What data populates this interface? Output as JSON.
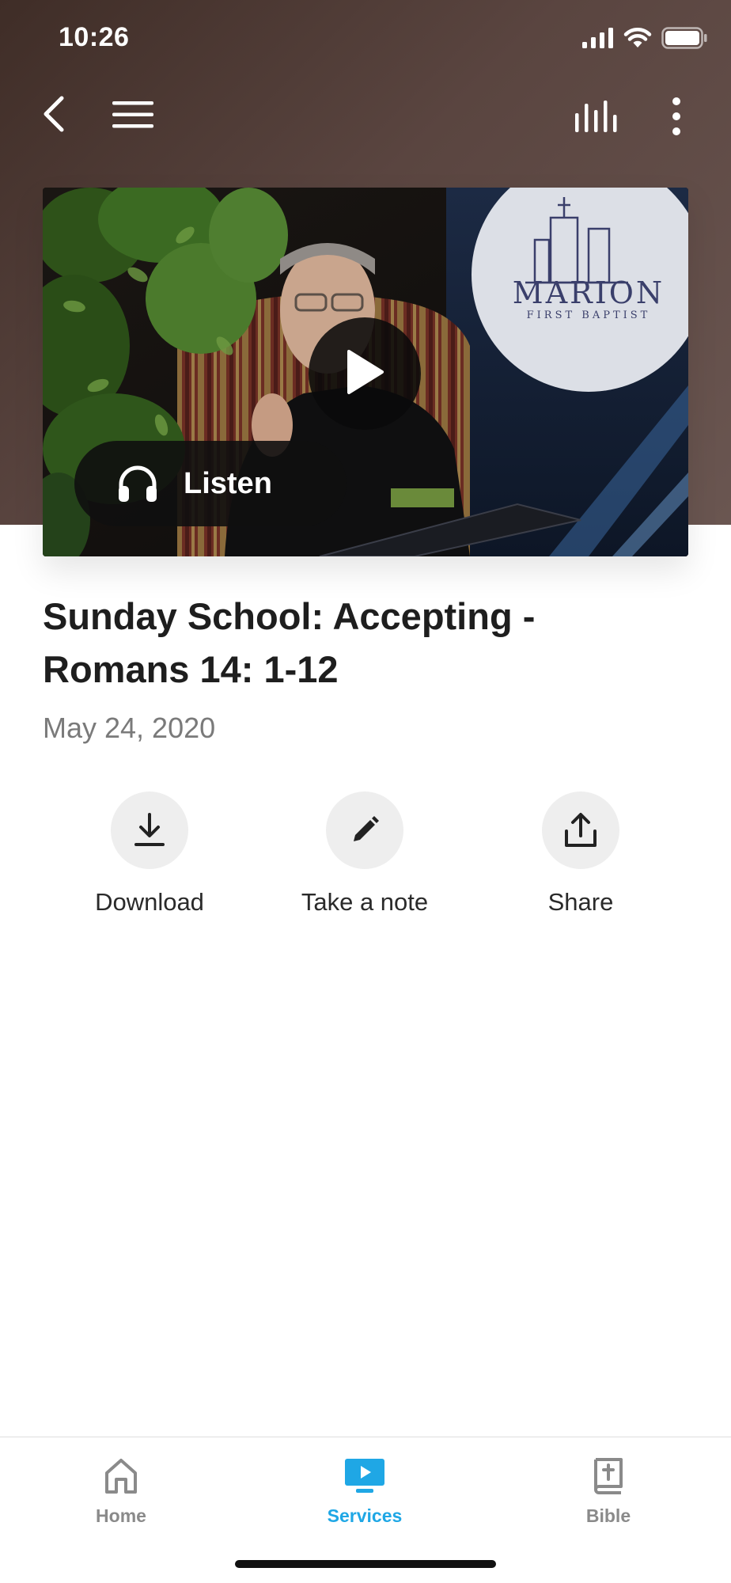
{
  "status_bar": {
    "time": "10:26",
    "icons": [
      "cellular-signal-icon",
      "wifi-icon",
      "battery-icon"
    ]
  },
  "nav": {
    "icons": [
      "back-chevron-icon",
      "hamburger-menu-icon",
      "audio-bars-icon",
      "more-vertical-icon"
    ]
  },
  "video": {
    "thumbnail_logo_main": "MARION",
    "thumbnail_logo_sub": "FIRST BAPTIST",
    "play_icon": "play-icon",
    "listen_label": "Listen",
    "listen_icon": "headphones-icon"
  },
  "sermon": {
    "title": "Sunday School: Accepting - Romans 14: 1-12",
    "date": "May 24, 2020"
  },
  "actions": [
    {
      "label": "Download",
      "icon": "download-icon"
    },
    {
      "label": "Take a note",
      "icon": "pencil-icon"
    },
    {
      "label": "Share",
      "icon": "share-icon"
    }
  ],
  "tabs": [
    {
      "label": "Home",
      "icon": "home-icon",
      "active": false
    },
    {
      "label": "Services",
      "icon": "tv-play-icon",
      "active": true
    },
    {
      "label": "Bible",
      "icon": "bible-icon",
      "active": false
    }
  ],
  "colors": {
    "header_brown": "#5a4540",
    "accent_blue": "#1fa7e5",
    "action_circle_gray": "#eeeeee",
    "date_gray": "#7a7a7a"
  }
}
